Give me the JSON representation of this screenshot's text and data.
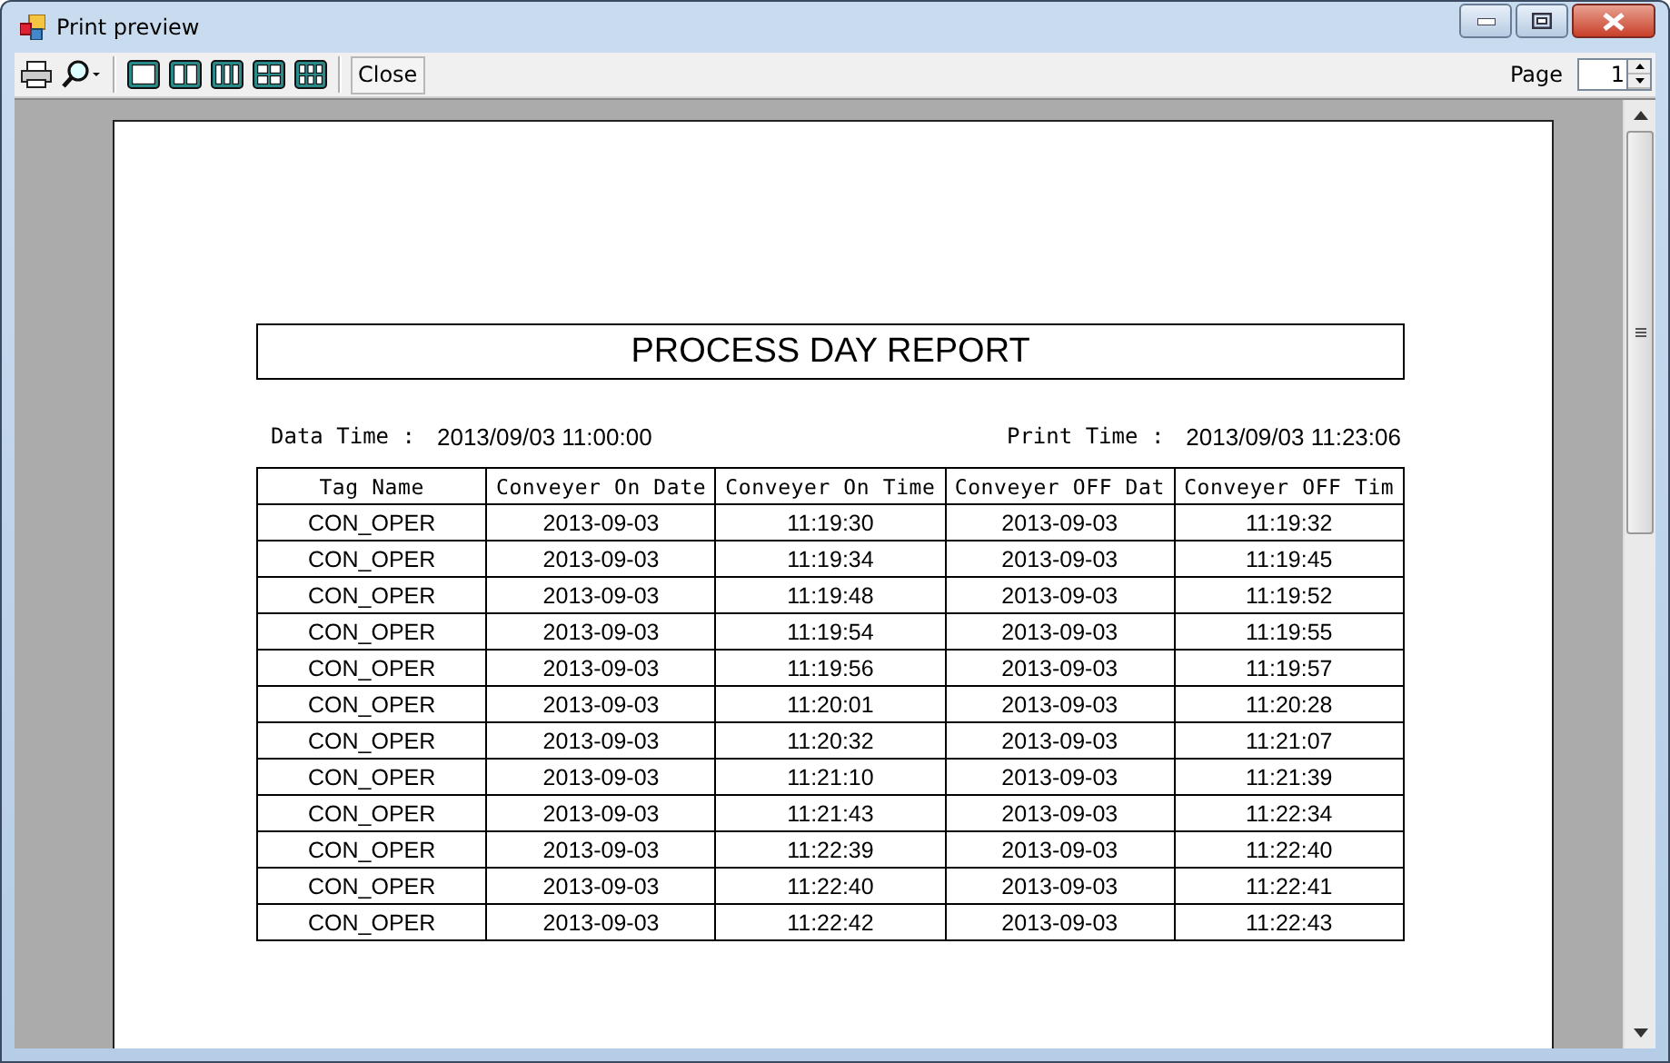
{
  "window": {
    "title": "Print preview"
  },
  "toolbar": {
    "close_label": "Close",
    "page_label": "Page",
    "page_value": "1"
  },
  "report": {
    "title": "PROCESS DAY REPORT",
    "data_time_label": "Data Time :",
    "data_time": "2013/09/03 11:00:00",
    "print_time_label": "Print Time :",
    "print_time": "2013/09/03 11:23:06",
    "columns": [
      "Tag Name",
      "Conveyer On Date",
      "Conveyer On Time",
      "Conveyer OFF Dat",
      "Conveyer OFF Tim"
    ],
    "rows": [
      [
        "CON_OPER",
        "2013-09-03",
        "11:19:30",
        "2013-09-03",
        "11:19:32"
      ],
      [
        "CON_OPER",
        "2013-09-03",
        "11:19:34",
        "2013-09-03",
        "11:19:45"
      ],
      [
        "CON_OPER",
        "2013-09-03",
        "11:19:48",
        "2013-09-03",
        "11:19:52"
      ],
      [
        "CON_OPER",
        "2013-09-03",
        "11:19:54",
        "2013-09-03",
        "11:19:55"
      ],
      [
        "CON_OPER",
        "2013-09-03",
        "11:19:56",
        "2013-09-03",
        "11:19:57"
      ],
      [
        "CON_OPER",
        "2013-09-03",
        "11:20:01",
        "2013-09-03",
        "11:20:28"
      ],
      [
        "CON_OPER",
        "2013-09-03",
        "11:20:32",
        "2013-09-03",
        "11:21:07"
      ],
      [
        "CON_OPER",
        "2013-09-03",
        "11:21:10",
        "2013-09-03",
        "11:21:39"
      ],
      [
        "CON_OPER",
        "2013-09-03",
        "11:21:43",
        "2013-09-03",
        "11:22:34"
      ],
      [
        "CON_OPER",
        "2013-09-03",
        "11:22:39",
        "2013-09-03",
        "11:22:40"
      ],
      [
        "CON_OPER",
        "2013-09-03",
        "11:22:40",
        "2013-09-03",
        "11:22:41"
      ],
      [
        "CON_OPER",
        "2013-09-03",
        "11:22:42",
        "2013-09-03",
        "11:22:43"
      ]
    ]
  }
}
